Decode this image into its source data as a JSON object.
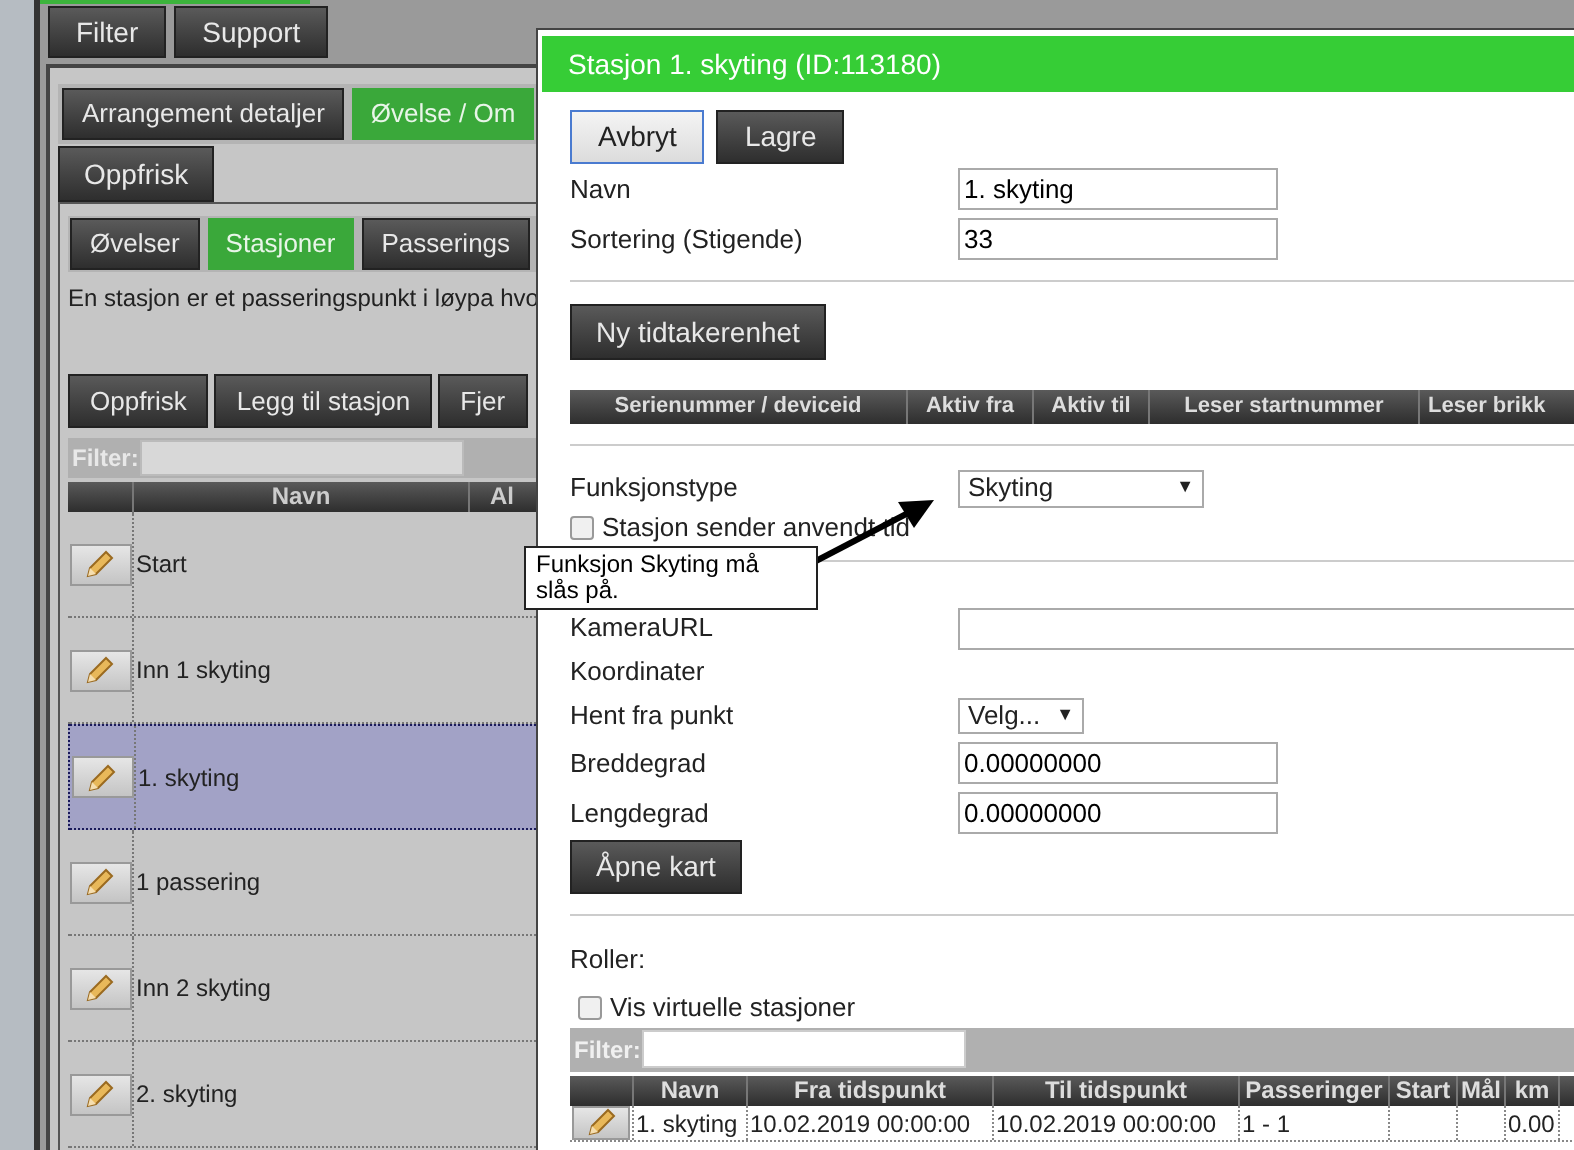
{
  "top_buttons": [
    {
      "label": "Filter"
    },
    {
      "label": "Support"
    }
  ],
  "main_tabs": [
    {
      "label": "Arrangement detaljer",
      "selected": false
    },
    {
      "label": "Øvelse / Om",
      "selected": true
    }
  ],
  "refresh_tab": "Oppfrisk",
  "sub_tabs": [
    {
      "label": "Øvelser",
      "selected": false
    },
    {
      "label": "Stasjoner",
      "selected": true
    },
    {
      "label": "Passerings",
      "selected": false
    }
  ],
  "description": "En stasjon er et passeringspunkt i løypa hvo",
  "toolbar": [
    "Oppfrisk",
    "Legg til stasjon",
    "Fjer"
  ],
  "filter_label": "Filter:",
  "stations_table": {
    "columns": [
      "Navn",
      "Al"
    ],
    "rows": [
      {
        "name": "Start",
        "selected": false
      },
      {
        "name": "Inn 1 skyting",
        "selected": false
      },
      {
        "name": "1. skyting",
        "selected": true
      },
      {
        "name": "1 passering",
        "selected": false
      },
      {
        "name": "Inn 2 skyting",
        "selected": false
      },
      {
        "name": "2. skyting",
        "selected": false
      }
    ]
  },
  "dialog": {
    "title": "Stasjon 1. skyting (ID:113180)",
    "buttons": [
      {
        "label": "Avbryt",
        "kind": "light"
      },
      {
        "label": "Lagre",
        "kind": "dark"
      }
    ],
    "fields": [
      {
        "label": "Navn",
        "value": "1. skyting"
      },
      {
        "label": "Sortering (Stigende)",
        "value": "33"
      }
    ],
    "new_device_button": "Ny tidtakerenhet",
    "device_columns": [
      "Serienummer / deviceid",
      "Aktiv fra",
      "Aktiv til",
      "Leser startnummer",
      "Leser brikk"
    ],
    "function_label": "Funksjonstype",
    "function_value": "Skyting",
    "sends_time": {
      "label": "Stasjon sender anvendt tid",
      "checked": false
    },
    "camera_label": "KameraURL",
    "coordinates_label": "Koordinater",
    "fetch_label": "Hent fra punkt",
    "fetch_value": "Velg...",
    "coords": [
      {
        "label": "Breddegrad",
        "value": "0.00000000"
      },
      {
        "label": "Lengdegrad",
        "value": "0.00000000"
      }
    ],
    "map_button": "Åpne kart",
    "roles_label": "Roller:",
    "virtual": {
      "label": "Vis virtuelle stasjoner",
      "checked": false
    },
    "filter_label": "Filter:",
    "roles_columns": [
      "Navn",
      "Fra tidspunkt",
      "Til tidspunkt",
      "Passeringer",
      "Start",
      "Mål",
      "km"
    ],
    "roles_rows": [
      [
        "1. skyting",
        "10.02.2019 00:00:00",
        "10.02.2019 00:00:00",
        "1 - 1",
        "",
        "",
        "0.00"
      ]
    ]
  },
  "callout": {
    "text": "Funksjon Skyting må slås på."
  },
  "caret": "▼"
}
